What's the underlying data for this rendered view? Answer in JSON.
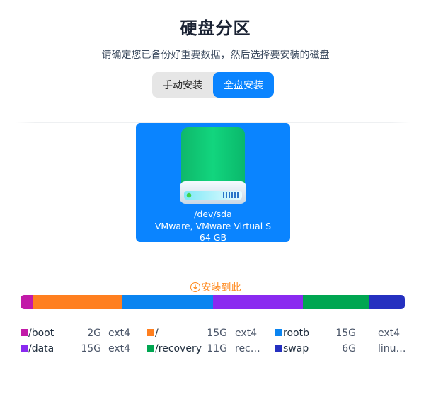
{
  "page": {
    "title": "硬盘分区",
    "subtitle": "请确定您已备份好重要数据，然后选择要安装的磁盘"
  },
  "mode_switch": {
    "options": [
      "手动安装",
      "全盘安装"
    ],
    "selected": "全盘安装"
  },
  "disk": {
    "path": "/dev/sda",
    "model": "VMware, VMware Virtual S",
    "size": "64 GB",
    "selected": true,
    "icon": "hard-drive-icon"
  },
  "install_here": {
    "label": "安装到此",
    "icon": "download-circle-icon",
    "color": "#ff8a1f"
  },
  "partitions": [
    {
      "name": "/boot",
      "size": "2G",
      "fs": "ext4",
      "size_gb": 2,
      "color": "#c21aa8"
    },
    {
      "name": "/",
      "size": "15G",
      "fs": "ext4",
      "size_gb": 15,
      "color": "#ff7f1f"
    },
    {
      "name": "rootb",
      "size": "15G",
      "fs": "ext4",
      "size_gb": 15,
      "color": "#0a84f0"
    },
    {
      "name": "/data",
      "size": "15G",
      "fs": "ext4",
      "size_gb": 15,
      "color": "#8a2af0"
    },
    {
      "name": "/recovery",
      "size": "11G",
      "fs": "rec…",
      "size_gb": 11,
      "color": "#00a651"
    },
    {
      "name": "swap",
      "size": "6G",
      "fs": "linu…",
      "size_gb": 6,
      "color": "#2530c0"
    }
  ]
}
